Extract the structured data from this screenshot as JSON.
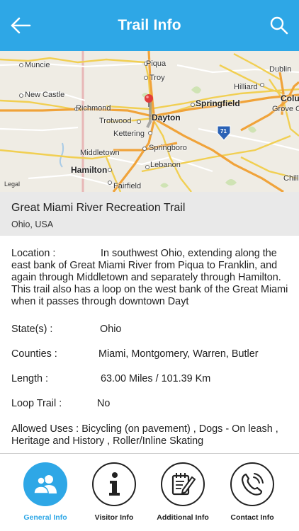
{
  "header": {
    "title": "Trail Info",
    "back_icon": "arrow-left-icon",
    "search_icon": "search-icon",
    "bg_color": "#2ea7e6"
  },
  "map": {
    "labels": [
      "Muncie",
      "Piqua",
      "Troy",
      "Dublin",
      "New Castle",
      "Hilliard",
      "Colu",
      "Richmond",
      "Springfield",
      "Grove C",
      "Trotwood",
      "Dayton",
      "Kettering",
      "71",
      "Springboro",
      "Middletown",
      "Lebanon",
      "Hamilton",
      "Chill",
      "Fairfield"
    ],
    "legal": "Legal"
  },
  "trail": {
    "name": "Great Miami River Recreation Trail",
    "location": "Ohio, USA"
  },
  "details": {
    "location_label": "Location  :",
    "location_value": "In southwest Ohio, extending along the east bank of Great Miami River from Piqua to Franklin, and again through Middletown and separately through Hamilton. This trail also has a loop on the west bank of the Great Miami when it passes through downtown Dayt",
    "states_label": "State(s)  :",
    "states_value": "Ohio",
    "counties_label": "Counties  :",
    "counties_value": "Miami, Montgomery, Warren, Butler",
    "length_label": "Length   :",
    "length_value": "63.00 Miles / 101.39 Km",
    "loop_label": "Loop Trail  :",
    "loop_value": "No",
    "uses_label": "Allowed Uses  :",
    "uses_value": "Bicycling (on pavement) , Dogs - On leash , Heritage and History , Roller/Inline Skating"
  },
  "tabs": [
    {
      "label": "General Info",
      "icon": "people-icon",
      "active": true
    },
    {
      "label": "Visitor Info",
      "icon": "info-icon",
      "active": false
    },
    {
      "label": "Additional Info",
      "icon": "edit-document-icon",
      "active": false
    },
    {
      "label": "Contact Info",
      "icon": "phone-icon",
      "active": false
    }
  ]
}
